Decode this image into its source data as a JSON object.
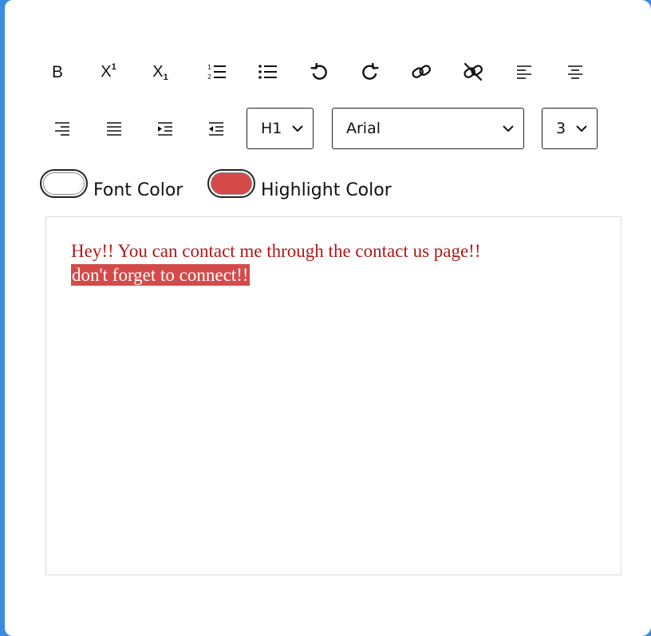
{
  "toolbar": {
    "bold": {
      "label": "B",
      "icon": "bold-icon"
    },
    "superscript": {
      "label": "X",
      "sup": "1",
      "icon": "superscript-icon"
    },
    "subscript": {
      "label": "X",
      "sub": "1",
      "icon": "subscript-icon"
    },
    "ordered_list": {
      "icon": "ordered-list-icon"
    },
    "unordered_list": {
      "icon": "unordered-list-icon"
    },
    "undo": {
      "icon": "undo-icon"
    },
    "redo": {
      "icon": "redo-icon"
    },
    "link": {
      "icon": "link-icon"
    },
    "unlink": {
      "icon": "unlink-icon"
    },
    "align_left": {
      "icon": "align-left-icon"
    },
    "align_center": {
      "icon": "align-center-icon"
    },
    "align_right": {
      "icon": "align-right-icon"
    },
    "justify": {
      "icon": "align-justify-icon"
    },
    "indent": {
      "icon": "indent-icon"
    },
    "outdent": {
      "icon": "outdent-icon"
    },
    "heading_select": {
      "value": "H1"
    },
    "font_select": {
      "value": "Arial"
    },
    "size_select": {
      "value": "3"
    }
  },
  "colors": {
    "font_color": {
      "label": "Font Color",
      "value": "#ffffff"
    },
    "highlight_color": {
      "label": "Highlight Color",
      "value": "#d44a4a"
    }
  },
  "editor": {
    "line1": "Hey!! You can contact me through the contact us page!!",
    "line2": "don't forget to connect!!",
    "text_color": "#b01818"
  },
  "theme": {
    "background": "#3d8be0"
  }
}
